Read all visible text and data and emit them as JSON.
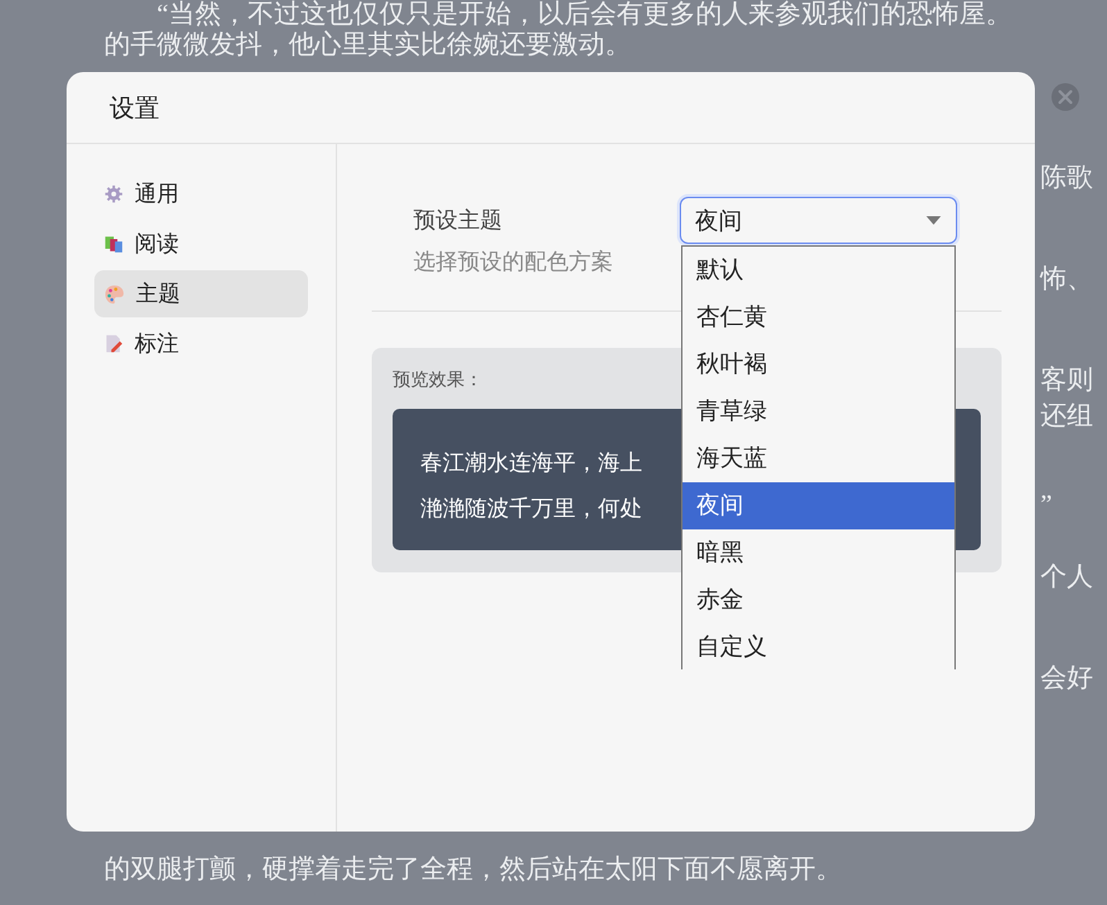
{
  "background_text": {
    "lines_top": [
      "“当然，不过这也仅仅只是开始，以后会有更多的人来参观我们的恐怖屋。",
      "的手微微发抖，他心里其实比徐婉还要激动。"
    ],
    "right_fragments": [
      {
        "text": "陈歌",
        "kind": "single"
      },
      {
        "text": "怖、",
        "kind": "single"
      },
      {
        "text": "客则",
        "kind": "pair"
      },
      {
        "text": "还组",
        "kind": "pair"
      },
      {
        "text": "”",
        "kind": "single"
      },
      {
        "text": "个人",
        "kind": "single"
      },
      {
        "text": "会好",
        "kind": "single"
      }
    ],
    "lines_bottom": [
      "的双腿打颤，硬撑着走完了全程，然后站在太阳下面不愿离开。"
    ]
  },
  "dialog": {
    "title": "设置",
    "sidebar": {
      "items": [
        {
          "label": "通用",
          "kind": "gear",
          "selected": false
        },
        {
          "label": "阅读",
          "kind": "books",
          "selected": false
        },
        {
          "label": "主题",
          "kind": "palette",
          "selected": true
        },
        {
          "label": "标注",
          "kind": "note",
          "selected": false
        }
      ]
    },
    "setting": {
      "label": "预设主题",
      "description": "选择预设的配色方案",
      "select": {
        "value": "夜间",
        "expanded": true,
        "options": [
          {
            "label": "默认",
            "selected": false
          },
          {
            "label": "杏仁黄",
            "selected": false
          },
          {
            "label": "秋叶褐",
            "selected": false
          },
          {
            "label": "青草绿",
            "selected": false
          },
          {
            "label": "海天蓝",
            "selected": false
          },
          {
            "label": "夜间",
            "selected": true
          },
          {
            "label": "暗黑",
            "selected": false
          },
          {
            "label": "赤金",
            "selected": false
          },
          {
            "label": "自定义",
            "selected": false
          }
        ]
      }
    },
    "preview": {
      "label": "预览效果：",
      "lines": [
        "春江潮水连海平，海上",
        "滟滟随波千万里，何处"
      ]
    }
  }
}
